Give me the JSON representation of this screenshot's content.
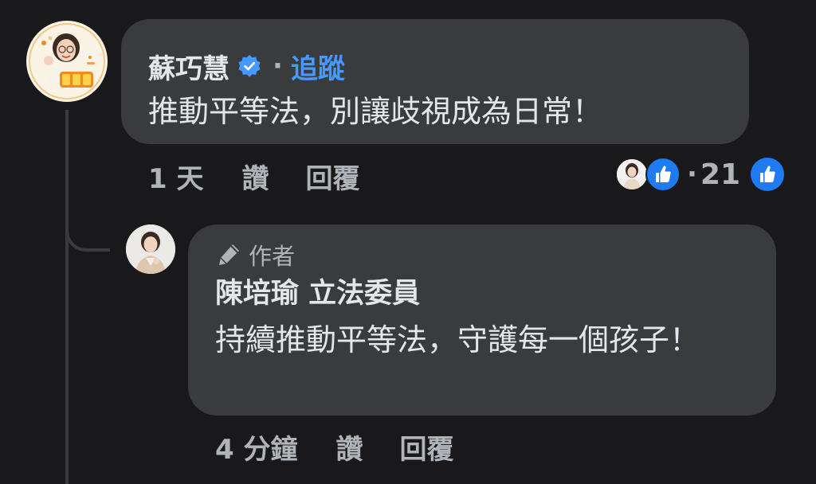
{
  "comment": {
    "author": "蘇巧慧",
    "separator": "·",
    "follow_label": "追蹤",
    "text": "推動平等法，別讓歧視成為日常！",
    "time": "1 天",
    "like_label": "讚",
    "reply_label": "回覆",
    "reaction_separator": "·",
    "reaction_count": "21",
    "accent_color": "#4599ff"
  },
  "reply": {
    "badge_label": "作者",
    "author": "陳培瑜 立法委員",
    "text": "持續推動平等法，守護每一個孩子！",
    "time": "4 分鐘",
    "like_label": "讚",
    "reply_label": "回覆"
  },
  "icons": {
    "verified": "verified-badge-icon",
    "like_reaction": "thumbs-up-icon",
    "author_badge": "pen-icon"
  }
}
